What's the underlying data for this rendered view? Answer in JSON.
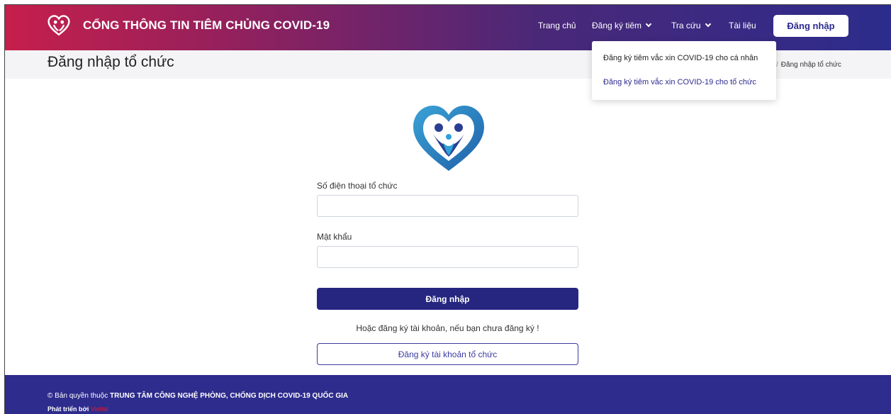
{
  "header": {
    "title": "CỔNG THÔNG TIN TIÊM CHỦNG COVID-19",
    "logo_icon": "heart-family-logo-icon",
    "nav": {
      "home": "Trang chủ",
      "register": "Đăng ký tiêm",
      "lookup": "Tra cứu",
      "docs": "Tài liệu"
    },
    "login_label": "Đăng nhập"
  },
  "dropdown": {
    "items": [
      "Đăng ký tiêm vắc xin COVID-19 cho cá nhân",
      "Đăng ký tiêm vắc xin COVID-19 cho tổ chức"
    ]
  },
  "page": {
    "title": "Đăng nhập tổ chức",
    "breadcrumb_current": "Đăng nhập tổ chức"
  },
  "form": {
    "phone_label": "Số điện thoại tổ chức",
    "phone_value": "",
    "password_label": "Mật khẩu",
    "password_value": "",
    "submit_label": "Đăng nhập",
    "or_text": "Hoặc đăng ký tài khoản, nếu bạn chưa đăng ký !",
    "register_label": "Đăng ký tài khoản tổ chức"
  },
  "footer": {
    "copyright_prefix": "© Bản quyền thuộc ",
    "copyright_org": "TRUNG TÂM CÔNG NGHỆ PHÒNG, CHỐNG DỊCH COVID-19 QUỐC GIA",
    "dev_prefix": "Phát triển bởi ",
    "dev_brand": "Viettel"
  },
  "colors": {
    "header_start": "#c61f4b",
    "header_end": "#2c2c8c",
    "primary": "#262680",
    "footer": "#2e2c8c",
    "viettel_red": "#e8172b"
  }
}
